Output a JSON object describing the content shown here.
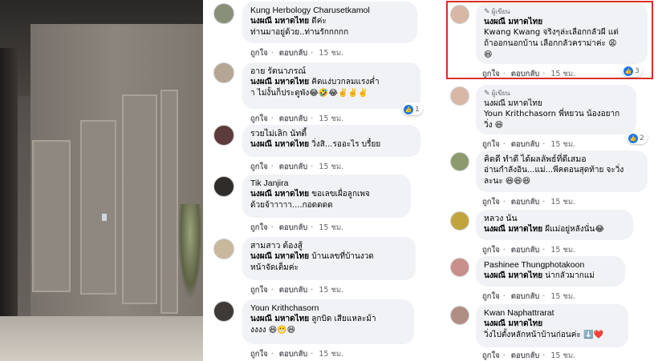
{
  "labels": {
    "like": "ถูกใจ",
    "reply": "ตอบกลับ",
    "dot": "·",
    "author_badge": "ผู้เขียน"
  },
  "colors": {
    "bubble": "#f0f2f5",
    "link": "#65676b",
    "like": "#1877f2",
    "highlight": "#d93025"
  },
  "left_comments": [
    {
      "name": "Kung Herbology Charusetkamol",
      "mention": "นงผณี มหาดไทย",
      "line1": " ดีค่ะ",
      "line2": "ท่านมาอยู่ด้วย..ท่านรักกกกก",
      "time": "15 ชม."
    },
    {
      "name": "อาย รัตนาภรณ์",
      "mention": "นงผณี มหาดไทย",
      "line1": " คิดแง่บวกลมแรงค่ำ",
      "line2": "า ไม่งั้นก็ประตูพัง😂🤣😂✌️✌️✌️",
      "time": "15 ชม.",
      "reactions": "1"
    },
    {
      "name": "รวยไม่เลิก นัทตี้",
      "mention": "นงผณี มหาดไทย",
      "line1": " วิ่งสิ...รออะไร บรื๋ยย",
      "line2": "",
      "time": "15 ชม."
    },
    {
      "name": "Tik Janjira",
      "mention": "นงผณี มหาดไทย",
      "line1": " ขอเลขเผื่อลูกเพจ",
      "line2": "ด้วยจ้าาาาา....กอดดดด",
      "time": "15 ชม."
    },
    {
      "name": "สามสาว ต้องสู้",
      "mention": "นงผณี มหาดไทย",
      "line1": " บ้านเลขที่บ้านงวด",
      "line2": "หน้าจัดเต็มค่ะ",
      "time": "15 ชม."
    },
    {
      "name": "Youn Krithchasorn",
      "mention": "นงผณี มหาดไทย",
      "line1": " ลูกบิด เสียแหละม้า",
      "line2": "งงงง 😆😬😆",
      "time": "15 ชม."
    }
  ],
  "right_comments": [
    {
      "badge": true,
      "mention": "นงผณี มหาดไทย",
      "line1": "Kwang Kwang จริงๆล่ะเลือกกลัวผี แต่",
      "line2": "ถ้าออกนอกบ้าน เลือกกลัวคราม่าค่ะ 😩",
      "line3": "😆",
      "time": "15 ชม.",
      "reactions": "3"
    },
    {
      "badge": true,
      "name": "นงผณี มหาดไทย",
      "mention": "Youn Krithchasorn",
      "line1": " พี่หยวน น้องอยาก",
      "line2": "วิ่ง 😆",
      "time": "15 ชม.",
      "reactions": "2"
    },
    {
      "name": "คิดดี ทำดี ได้ผลลัพธ์ที่ดีเสมอ",
      "line1": "อ่านกำลังอิน...แม่...พีคตอนสุดท้าย จะวิ่ง",
      "line2": "ละนะ 😆😆😆",
      "time": "15 ชม."
    },
    {
      "name": "หลวง นัน",
      "mention": "นงผณี มหาดไทย",
      "line1": " ผีแม่อยู่หลังนั่น😂",
      "line2": "",
      "time": "15 ชม."
    },
    {
      "name": "Pashinee Thungphotakoon",
      "mention": "นงผณี มหาดไทย",
      "line1": " น่ากลัวมากแม่",
      "line2": "",
      "time": "15 ชม."
    },
    {
      "name": "Kwan Naphattrarat",
      "mention": "นงผณี มหาดไทย",
      "line1": "",
      "line2": "วิ่งไปตั้งหลักหน้าบ้านก่อนค่ะ ⬇️❤️",
      "time": "15 ชม."
    }
  ]
}
